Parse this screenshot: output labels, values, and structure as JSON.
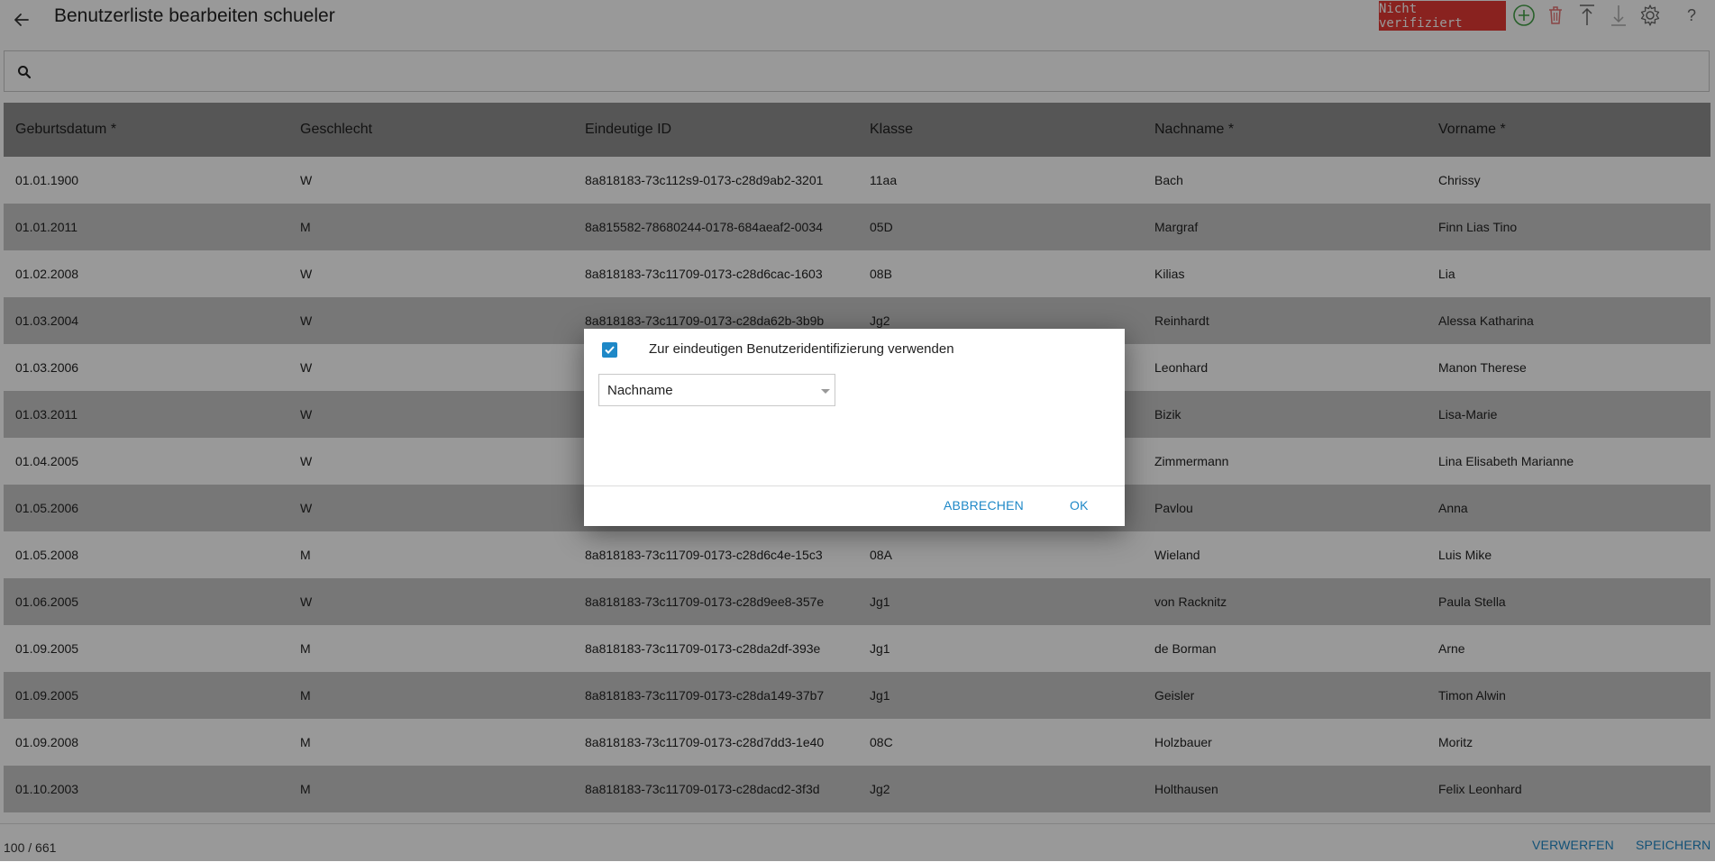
{
  "header": {
    "title": "Benutzerliste bearbeiten schueler",
    "status_badge": "Nicht verifiziert",
    "help_label": "?"
  },
  "colors": {
    "accent": "#1e88c7",
    "badge": "#e53935",
    "add_icon": "#43a047",
    "delete_icon": "#e53935"
  },
  "search": {
    "placeholder": ""
  },
  "table": {
    "columns": [
      "Geburtsdatum *",
      "Geschlecht",
      "Eindeutige ID",
      "Klasse",
      "Nachname *",
      "Vorname *"
    ],
    "rows": [
      [
        "01.01.1900",
        "W",
        "8a818183-73c112s9-0173-c28d9ab2-3201",
        "11aa",
        "Bach",
        "Chrissy"
      ],
      [
        "01.01.2011",
        "M",
        "8a815582-78680244-0178-684aeaf2-0034",
        "05D",
        "Margraf",
        "Finn Lias Tino"
      ],
      [
        "01.02.2008",
        "W",
        "8a818183-73c11709-0173-c28d6cac-1603",
        "08B",
        "Kilias",
        "Lia"
      ],
      [
        "01.03.2004",
        "W",
        "8a818183-73c11709-0173-c28da62b-3b9b",
        "Jg2",
        "Reinhardt",
        "Alessa Katharina"
      ],
      [
        "01.03.2006",
        "W",
        "",
        "",
        "Leonhard",
        "Manon Therese"
      ],
      [
        "01.03.2011",
        "W",
        "",
        "",
        "Bizik",
        "Lisa-Marie"
      ],
      [
        "01.04.2005",
        "W",
        "",
        "",
        "Zimmermann",
        "Lina Elisabeth Marianne"
      ],
      [
        "01.05.2006",
        "W",
        "",
        "",
        "Pavlou",
        "Anna"
      ],
      [
        "01.05.2008",
        "M",
        "8a818183-73c11709-0173-c28d6c4e-15c3",
        "08A",
        "Wieland",
        "Luis Mike"
      ],
      [
        "01.06.2005",
        "W",
        "8a818183-73c11709-0173-c28d9ee8-357e",
        "Jg1",
        "von Racknitz",
        "Paula Stella"
      ],
      [
        "01.09.2005",
        "M",
        "8a818183-73c11709-0173-c28da2df-393e",
        "Jg1",
        "de Borman",
        "Arne"
      ],
      [
        "01.09.2005",
        "M",
        "8a818183-73c11709-0173-c28da149-37b7",
        "Jg1",
        "Geisler",
        "Timon Alwin"
      ],
      [
        "01.09.2008",
        "M",
        "8a818183-73c11709-0173-c28d7dd3-1e40",
        "08C",
        "Holzbauer",
        "Moritz"
      ],
      [
        "01.10.2003",
        "M",
        "8a818183-73c11709-0173-c28dacd2-3f3d",
        "Jg2",
        "Holthausen",
        "Felix Leonhard"
      ]
    ]
  },
  "footer": {
    "count": "100 / 661",
    "discard_label": "VERWERFEN",
    "save_label": "SPEICHERN"
  },
  "dialog": {
    "checkbox_label": "Zur eindeutigen Benutzeridentifizierung verwenden",
    "checkbox_checked": true,
    "select_value": "Nachname",
    "cancel_label": "ABBRECHEN",
    "ok_label": "OK"
  }
}
